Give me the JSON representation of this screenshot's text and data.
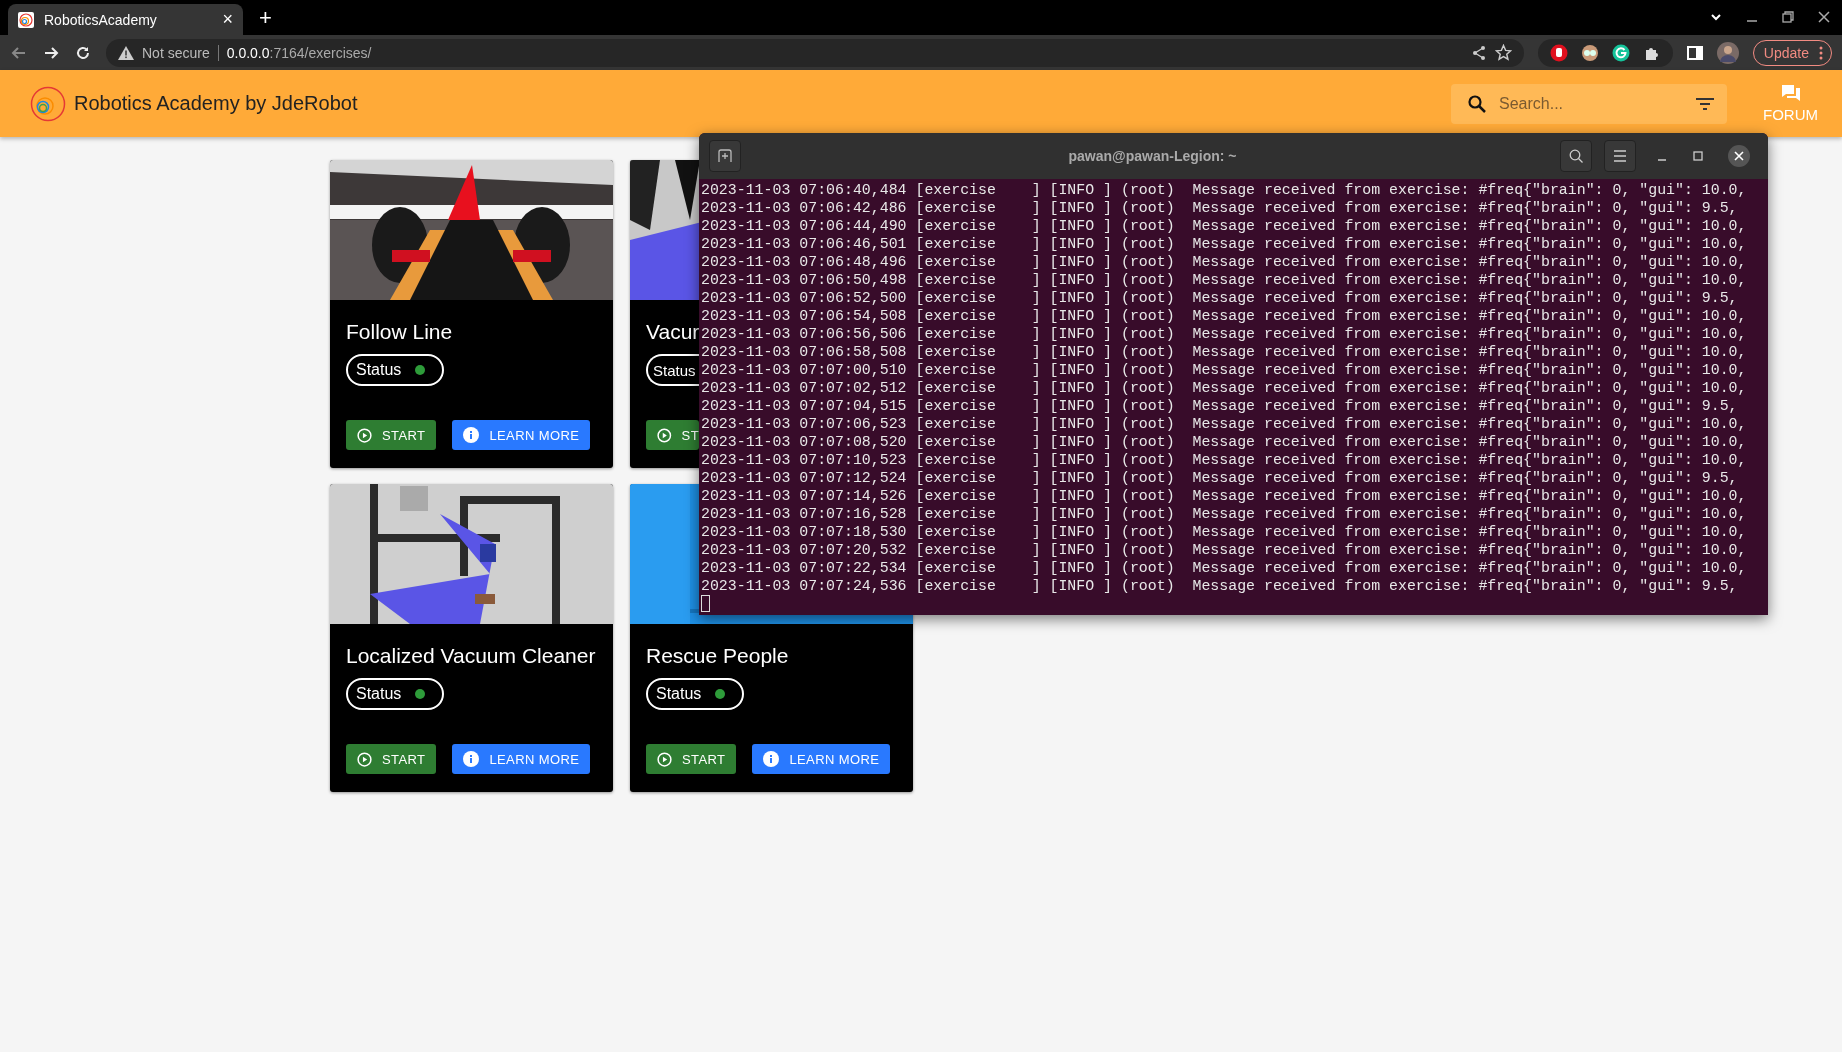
{
  "browser": {
    "tab": {
      "title": "RoboticsAcademy",
      "close": "×"
    },
    "new_tab": "+",
    "security": "Not secure",
    "url_host": "0.0.0.0",
    "url_path": ":7164/exercises/",
    "update_button": "Update"
  },
  "header": {
    "title": "Robotics Academy by JdeRobot",
    "search": {
      "placeholder": "Search..."
    },
    "forum": "FORUM"
  },
  "cards": [
    {
      "title": "Follow Line",
      "status": "Status",
      "start": "START",
      "learn_more": "LEARN MORE"
    },
    {
      "title": "Vacur",
      "status": "Status",
      "start": "ST"
    },
    {
      "title": "Localized Vacuum Cleaner",
      "status": "Status",
      "start": "START",
      "learn_more": "LEARN MORE"
    },
    {
      "title": "Rescue People",
      "status": "Status",
      "start": "START",
      "learn_more": "LEARN MORE"
    }
  ],
  "terminal": {
    "title": "pawan@pawan-Legion: ~",
    "lines": [
      "2023-11-03 07:06:40,484 [exercise    ] [INFO ] (root)  Message received from exercise: #freq{\"brain\": 0, \"gui\": 10.0,",
      "2023-11-03 07:06:42,486 [exercise    ] [INFO ] (root)  Message received from exercise: #freq{\"brain\": 0, \"gui\": 9.5,",
      "2023-11-03 07:06:44,490 [exercise    ] [INFO ] (root)  Message received from exercise: #freq{\"brain\": 0, \"gui\": 10.0,",
      "2023-11-03 07:06:46,501 [exercise    ] [INFO ] (root)  Message received from exercise: #freq{\"brain\": 0, \"gui\": 10.0,",
      "2023-11-03 07:06:48,496 [exercise    ] [INFO ] (root)  Message received from exercise: #freq{\"brain\": 0, \"gui\": 10.0,",
      "2023-11-03 07:06:50,498 [exercise    ] [INFO ] (root)  Message received from exercise: #freq{\"brain\": 0, \"gui\": 10.0,",
      "2023-11-03 07:06:52,500 [exercise    ] [INFO ] (root)  Message received from exercise: #freq{\"brain\": 0, \"gui\": 9.5,",
      "2023-11-03 07:06:54,508 [exercise    ] [INFO ] (root)  Message received from exercise: #freq{\"brain\": 0, \"gui\": 10.0,",
      "2023-11-03 07:06:56,506 [exercise    ] [INFO ] (root)  Message received from exercise: #freq{\"brain\": 0, \"gui\": 10.0,",
      "2023-11-03 07:06:58,508 [exercise    ] [INFO ] (root)  Message received from exercise: #freq{\"brain\": 0, \"gui\": 10.0,",
      "2023-11-03 07:07:00,510 [exercise    ] [INFO ] (root)  Message received from exercise: #freq{\"brain\": 0, \"gui\": 10.0,",
      "2023-11-03 07:07:02,512 [exercise    ] [INFO ] (root)  Message received from exercise: #freq{\"brain\": 0, \"gui\": 10.0,",
      "2023-11-03 07:07:04,515 [exercise    ] [INFO ] (root)  Message received from exercise: #freq{\"brain\": 0, \"gui\": 9.5,",
      "2023-11-03 07:07:06,523 [exercise    ] [INFO ] (root)  Message received from exercise: #freq{\"brain\": 0, \"gui\": 10.0,",
      "2023-11-03 07:07:08,520 [exercise    ] [INFO ] (root)  Message received from exercise: #freq{\"brain\": 0, \"gui\": 10.0,",
      "2023-11-03 07:07:10,523 [exercise    ] [INFO ] (root)  Message received from exercise: #freq{\"brain\": 0, \"gui\": 10.0,",
      "2023-11-03 07:07:12,524 [exercise    ] [INFO ] (root)  Message received from exercise: #freq{\"brain\": 0, \"gui\": 9.5,",
      "2023-11-03 07:07:14,526 [exercise    ] [INFO ] (root)  Message received from exercise: #freq{\"brain\": 0, \"gui\": 10.0,",
      "2023-11-03 07:07:16,528 [exercise    ] [INFO ] (root)  Message received from exercise: #freq{\"brain\": 0, \"gui\": 10.0,",
      "2023-11-03 07:07:18,530 [exercise    ] [INFO ] (root)  Message received from exercise: #freq{\"brain\": 0, \"gui\": 10.0,",
      "2023-11-03 07:07:20,532 [exercise    ] [INFO ] (root)  Message received from exercise: #freq{\"brain\": 0, \"gui\": 10.0,",
      "2023-11-03 07:07:22,534 [exercise    ] [INFO ] (root)  Message received from exercise: #freq{\"brain\": 0, \"gui\": 10.0,",
      "2023-11-03 07:07:24,536 [exercise    ] [INFO ] (root)  Message received from exercise: #freq{\"brain\": 0, \"gui\": 9.5,"
    ]
  }
}
